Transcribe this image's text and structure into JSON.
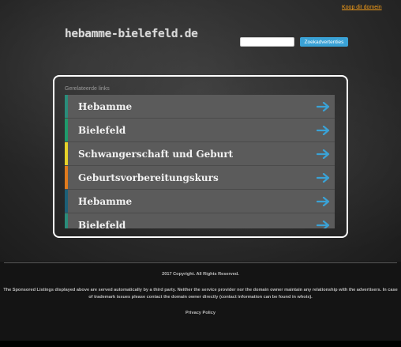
{
  "header": {
    "buy_domain_link": "Koop dit domein",
    "logo": "hebamme-bielefeld.de",
    "search_placeholder": "",
    "search_button": "Zoekadvertenties"
  },
  "related": {
    "title": "Gerelateerde links",
    "items": [
      {
        "label": "Hebamme",
        "color": "#2a8c7a"
      },
      {
        "label": "Bielefeld",
        "color": "#1f9a6b"
      },
      {
        "label": "Schwangerschaft und Geburt",
        "color": "#e6d22a"
      },
      {
        "label": "Geburtsvorbereitungskurs",
        "color": "#e07b1e"
      },
      {
        "label": "Hebamme",
        "color": "#1c5f77"
      },
      {
        "label": "Bielefeld",
        "color": "#2a8c7a"
      }
    ],
    "arrow_color": "#3aa2d6"
  },
  "footer": {
    "copyright": "2017 Copyright. All Rights Reserved.",
    "disclaimer": "The Sponsored Listings displayed above are served automatically by a third party. Neither the service provider nor the domain owner maintain any relationship with the advertisers. In case of trademark issues please contact the domain owner directly (contact information can be found in whois).",
    "privacy": "Privacy Policy"
  }
}
